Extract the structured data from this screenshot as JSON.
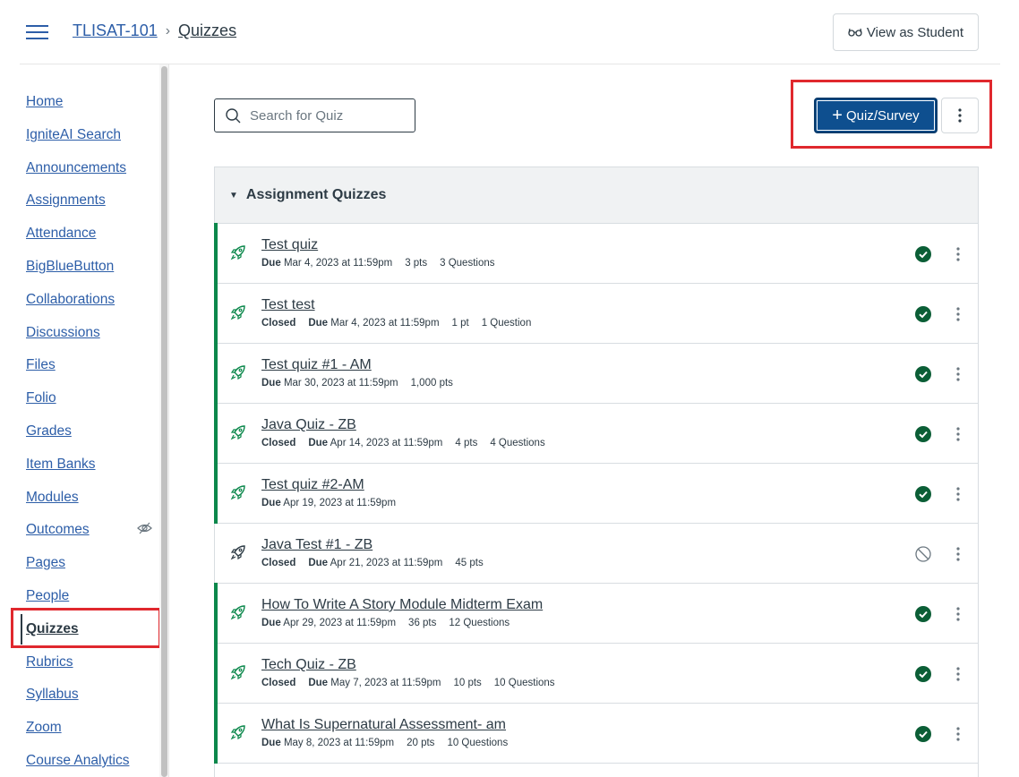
{
  "header": {
    "course_link": "TLISAT-101",
    "separator": "›",
    "current_page": "Quizzes",
    "view_as_student": "View as Student"
  },
  "sidebar": {
    "items": [
      {
        "label": "Home"
      },
      {
        "label": "IgniteAI Search"
      },
      {
        "label": "Announcements"
      },
      {
        "label": "Assignments"
      },
      {
        "label": "Attendance"
      },
      {
        "label": "BigBlueButton"
      },
      {
        "label": "Collaborations"
      },
      {
        "label": "Discussions"
      },
      {
        "label": "Files"
      },
      {
        "label": "Folio"
      },
      {
        "label": "Grades"
      },
      {
        "label": "Item Banks"
      },
      {
        "label": "Modules"
      },
      {
        "label": "Outcomes"
      },
      {
        "label": "Pages"
      },
      {
        "label": "People"
      },
      {
        "label": "Quizzes"
      },
      {
        "label": "Rubrics"
      },
      {
        "label": "Syllabus"
      },
      {
        "label": "Zoom"
      },
      {
        "label": "Course Analytics"
      }
    ]
  },
  "toolbar": {
    "search_placeholder": "Search for Quiz",
    "add_button": "Quiz/Survey",
    "add_plus": "+"
  },
  "group": {
    "title": "Assignment Quizzes",
    "quizzes": [
      {
        "title": "Test quiz",
        "closed": "",
        "due_label": "Due",
        "due": "Mar 4, 2023 at 11:59pm",
        "points": "3 pts",
        "questions": "3 Questions",
        "published": true
      },
      {
        "title": "Test test",
        "closed": "Closed",
        "due_label": "Due",
        "due": "Mar 4, 2023 at 11:59pm",
        "points": "1 pt",
        "questions": "1 Question",
        "published": true
      },
      {
        "title": "Test quiz #1 - AM",
        "closed": "",
        "due_label": "Due",
        "due": "Mar 30, 2023 at 11:59pm",
        "points": "1,000 pts",
        "questions": "",
        "published": true
      },
      {
        "title": "Java Quiz - ZB",
        "closed": "Closed",
        "due_label": "Due",
        "due": "Apr 14, 2023 at 11:59pm",
        "points": "4 pts",
        "questions": "4 Questions",
        "published": true
      },
      {
        "title": "Test quiz #2-AM",
        "closed": "",
        "due_label": "Due",
        "due": "Apr 19, 2023 at 11:59pm",
        "points": "",
        "questions": "",
        "published": true
      },
      {
        "title": "Java Test #1 - ZB",
        "closed": "Closed",
        "due_label": "Due",
        "due": "Apr 21, 2023 at 11:59pm",
        "points": "45 pts",
        "questions": "",
        "published": false
      },
      {
        "title": "How To Write A Story Module Midterm Exam",
        "closed": "",
        "due_label": "Due",
        "due": "Apr 29, 2023 at 11:59pm",
        "points": "36 pts",
        "questions": "12 Questions",
        "published": true
      },
      {
        "title": "Tech Quiz - ZB",
        "closed": "Closed",
        "due_label": "Due",
        "due": "May 7, 2023 at 11:59pm",
        "points": "10 pts",
        "questions": "10 Questions",
        "published": true
      },
      {
        "title": "What Is Supernatural Assessment- am",
        "closed": "",
        "due_label": "Due",
        "due": "May 8, 2023 at 11:59pm",
        "points": "20 pts",
        "questions": "10 Questions",
        "published": true
      }
    ]
  },
  "colors": {
    "link": "#2d5ea8",
    "primary_button": "#0e4f8f",
    "published_green": "#0b874b",
    "highlight_red": "#e0282e"
  }
}
